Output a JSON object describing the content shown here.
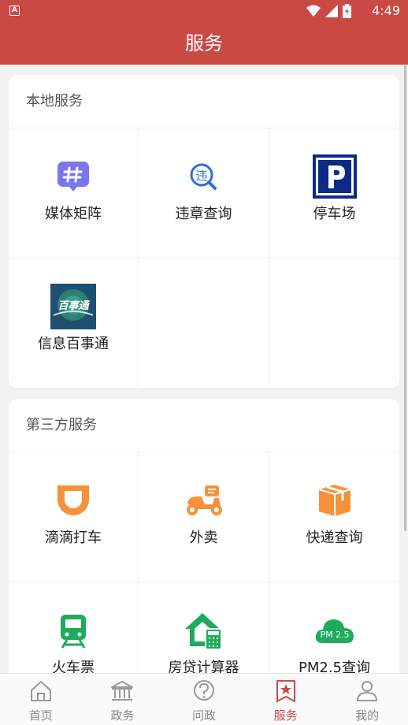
{
  "status_bar": {
    "time": "4:49",
    "notification_glyph": "A"
  },
  "header": {
    "title": "服务"
  },
  "sections": [
    {
      "title": "本地服务",
      "items": [
        {
          "label": "媒体矩阵",
          "icon": "hashtag-chat-icon"
        },
        {
          "label": "违章查询",
          "icon": "violation-search-icon"
        },
        {
          "label": "停车场",
          "icon": "parking-icon"
        },
        {
          "label": "信息百事通",
          "icon": "info-baishitong-icon",
          "icon_text": "百事通"
        }
      ]
    },
    {
      "title": "第三方服务",
      "items": [
        {
          "label": "滴滴打车",
          "icon": "didi-icon"
        },
        {
          "label": "外卖",
          "icon": "scooter-icon"
        },
        {
          "label": "快递查询",
          "icon": "package-icon"
        },
        {
          "label": "火车票",
          "icon": "train-icon"
        },
        {
          "label": "房贷计算器",
          "icon": "house-calculator-icon"
        },
        {
          "label": "PM2.5查询",
          "icon": "pm25-cloud-icon",
          "icon_text": "PM 2.5"
        }
      ]
    }
  ],
  "nav": [
    {
      "label": "首页",
      "icon": "home-icon",
      "active": false
    },
    {
      "label": "政务",
      "icon": "government-icon",
      "active": false
    },
    {
      "label": "问政",
      "icon": "question-icon",
      "active": false
    },
    {
      "label": "服务",
      "icon": "service-star-icon",
      "active": true
    },
    {
      "label": "我的",
      "icon": "user-icon",
      "active": false
    }
  ],
  "colors": {
    "primary": "#c94a45",
    "orange": "#f7923a",
    "green": "#1fab5e",
    "purple": "#7b76ee",
    "blue": "#2f6fd6"
  }
}
